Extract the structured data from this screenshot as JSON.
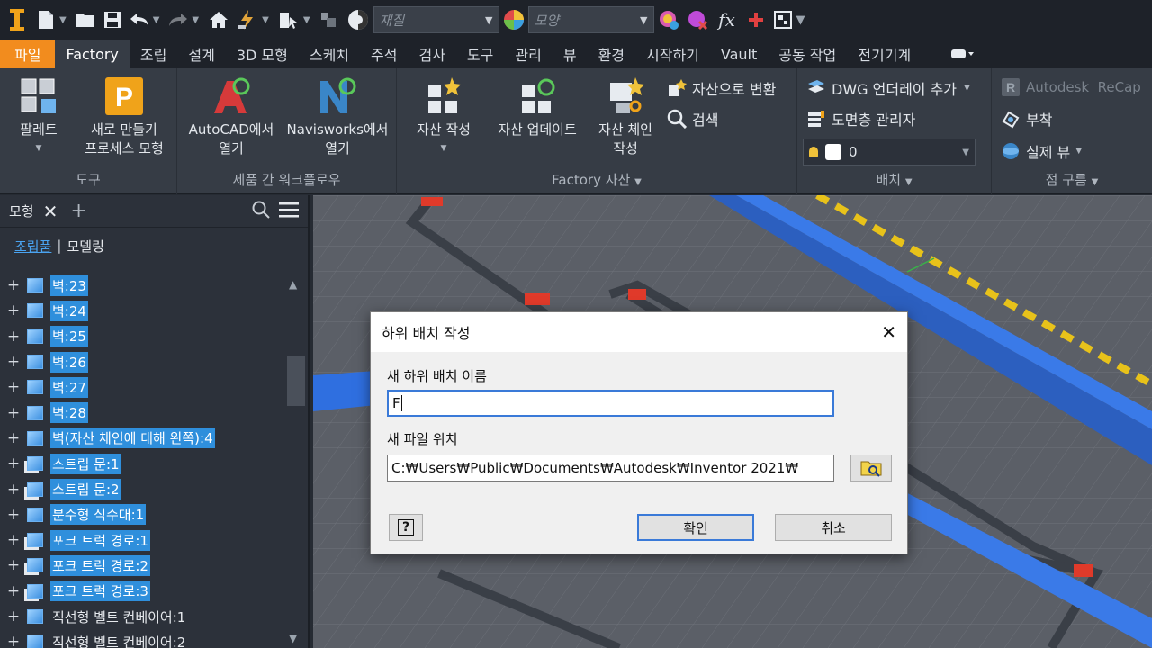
{
  "qat": {
    "material_placeholder": "재질",
    "appearance_placeholder": "모양",
    "fx_label": "fx"
  },
  "tabs": [
    {
      "label": "파일"
    },
    {
      "label": "Factory"
    },
    {
      "label": "조립"
    },
    {
      "label": "설계"
    },
    {
      "label": "3D 모형"
    },
    {
      "label": "스케치"
    },
    {
      "label": "주석"
    },
    {
      "label": "검사"
    },
    {
      "label": "도구"
    },
    {
      "label": "관리"
    },
    {
      "label": "뷰"
    },
    {
      "label": "환경"
    },
    {
      "label": "시작하기"
    },
    {
      "label": "Vault"
    },
    {
      "label": "공동 작업"
    },
    {
      "label": "전기기계"
    }
  ],
  "ribbon": {
    "tools": {
      "palette_label": "팔레트",
      "new_process_label": "새로 만들기\n프로세스 모형",
      "title": "도구"
    },
    "workflow": {
      "autocad_label": "AutoCAD에서\n열기",
      "navisworks_label": "Navisworks에서\n열기",
      "title": "제품 간 워크플로우"
    },
    "assets": {
      "create_label": "자산 작성",
      "update_label": "자산 업데이트",
      "chain_label": "자산 체인\n작성",
      "convert_label": "자산으로 변환",
      "search_label": "검색",
      "title": "Factory 자산"
    },
    "layout": {
      "dwg_label": "DWG 언더레이 추가",
      "layer_label": "도면층 관리자",
      "layer_value": "0",
      "title": "배치"
    },
    "pointcloud": {
      "recap_label": "Autodesk  ReCap",
      "attach_label": "부착",
      "realview_label": "실제 뷰",
      "title": "점 구름"
    }
  },
  "browser": {
    "tab_label": "모형",
    "sub_assembly": "조립품",
    "sub_modeling": "모델링",
    "items": [
      {
        "label": "벽:23",
        "selected": true,
        "icon": "cube"
      },
      {
        "label": "벽:24",
        "selected": true,
        "icon": "cube"
      },
      {
        "label": "벽:25",
        "selected": true,
        "icon": "cube"
      },
      {
        "label": "벽:26",
        "selected": true,
        "icon": "cube"
      },
      {
        "label": "벽:27",
        "selected": true,
        "icon": "cube"
      },
      {
        "label": "벽:28",
        "selected": true,
        "icon": "cube"
      },
      {
        "label": "벽(자산 체인에 대해 왼쪽):4",
        "selected": true,
        "icon": "cube"
      },
      {
        "label": "스트립 문:1",
        "selected": true,
        "icon": "subasm"
      },
      {
        "label": "스트립 문:2",
        "selected": true,
        "icon": "subasm"
      },
      {
        "label": "분수형 식수대:1",
        "selected": true,
        "icon": "cube"
      },
      {
        "label": "포크 트럭 경로:1",
        "selected": true,
        "icon": "subasm"
      },
      {
        "label": "포크 트럭 경로:2",
        "selected": true,
        "icon": "subasm"
      },
      {
        "label": "포크 트럭 경로:3",
        "selected": true,
        "icon": "subasm"
      },
      {
        "label": "직선형 벨트 컨베이어:1",
        "selected": false,
        "icon": "cube"
      },
      {
        "label": "직선형 벨트 컨베이어:2",
        "selected": false,
        "icon": "cube"
      }
    ]
  },
  "dialog": {
    "title": "하위 배치 작성",
    "name_label": "새 하위 배치 이름",
    "name_value": "F",
    "location_label": "새 파일 위치",
    "location_value": "C:₩Users₩Public₩Documents₩Autodesk₩Inventor 2021₩",
    "ok_label": "확인",
    "cancel_label": "취소",
    "help_label": "?"
  },
  "colors": {
    "accent_file_tab": "#f28c1e",
    "selection": "#2f8fdc",
    "ribbon_bg": "#363c45"
  }
}
